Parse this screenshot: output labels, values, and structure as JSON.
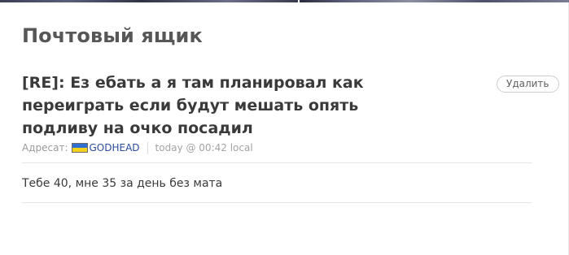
{
  "mailbox": {
    "title": "Почтовый ящик"
  },
  "message": {
    "subject": "[RE]: Ез ебать а я там планировал как переиграть если будут мешать опять подливу на очко посадил",
    "recipient_label": "Адресат:",
    "recipient_name": "GODHEAD",
    "recipient_flag_icon": "flag-icon",
    "timestamp": "today @ 00:42 local",
    "delete_label": "Удалить",
    "body": "Тебе 40, мне 35 за день без мата"
  },
  "colors": {
    "title": "#575757",
    "recipient_link": "#2a4c9c",
    "flag_top": "#2f6fd0",
    "flag_bottom": "#f2d21a"
  }
}
